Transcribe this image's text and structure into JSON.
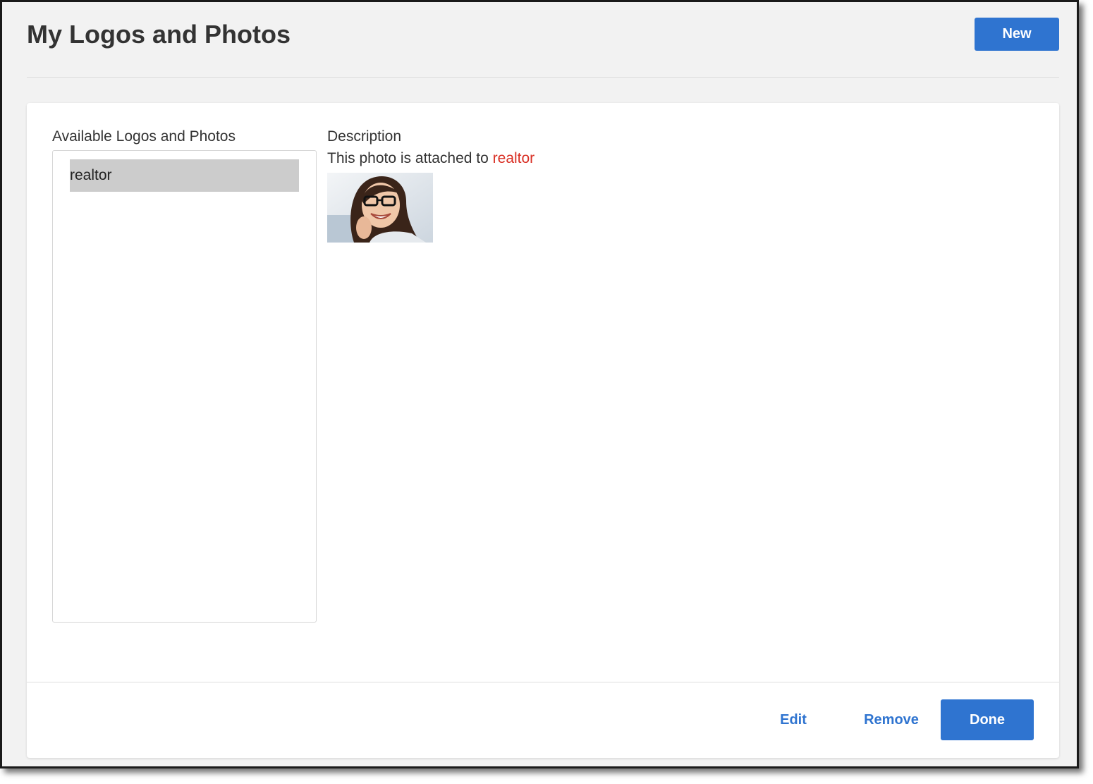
{
  "header": {
    "title": "My Logos and Photos",
    "new_label": "New"
  },
  "panel": {
    "available_label": "Available Logos and Photos",
    "items": [
      {
        "label": "realtor",
        "selected": true
      }
    ],
    "description_label": "Description",
    "description_text": "This photo is attached to ",
    "description_link": "realtor"
  },
  "footer": {
    "edit_label": "Edit",
    "remove_label": "Remove",
    "done_label": "Done"
  },
  "colors": {
    "accent": "#2f74d0",
    "link_red": "#d93025",
    "selected_bg": "#cccccc",
    "page_bg": "#f2f2f2"
  }
}
